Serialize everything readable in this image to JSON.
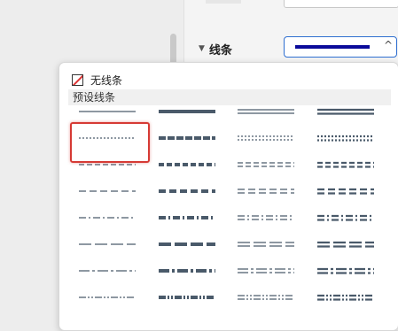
{
  "sidebar": {
    "section_title": "线条"
  },
  "line_select": {
    "preview_color": "#0a0a9a"
  },
  "dropdown": {
    "no_line_label": "无线条",
    "preset_header": "预设线条",
    "line_color": "#4a5a6a",
    "highlight_color": "#d63a34",
    "presets": [
      [
        {
          "name": "thin-solid",
          "style": "solid",
          "weight": "thin"
        },
        {
          "name": "thick-solid",
          "style": "solid",
          "weight": "thick"
        },
        {
          "name": "double-thin",
          "style": "solid",
          "weight": "double"
        },
        {
          "name": "double-thick",
          "style": "solid",
          "weight": "double-thick"
        }
      ],
      [
        {
          "name": "thin-dotted",
          "style": "dotted",
          "weight": "thin",
          "selected": true
        },
        {
          "name": "thick-square-dot",
          "style": "square-dot",
          "weight": "thick"
        },
        {
          "name": "double-dotted",
          "style": "dotted",
          "weight": "double"
        },
        {
          "name": "double-thick-dotted",
          "style": "dotted",
          "weight": "double-thick"
        }
      ],
      [
        {
          "name": "thin-dash",
          "style": "dash",
          "weight": "thin"
        },
        {
          "name": "thick-dash",
          "style": "dash",
          "weight": "thick"
        },
        {
          "name": "double-dash",
          "style": "dash",
          "weight": "double"
        },
        {
          "name": "double-thick-dash",
          "style": "dash",
          "weight": "double-thick"
        }
      ],
      [
        {
          "name": "thin-long-dash",
          "style": "long-dash",
          "weight": "thin"
        },
        {
          "name": "thick-long-dash",
          "style": "long-dash",
          "weight": "thick"
        },
        {
          "name": "double-long-dash",
          "style": "long-dash",
          "weight": "double"
        },
        {
          "name": "double-thick-long-dash",
          "style": "long-dash",
          "weight": "double-thick"
        }
      ],
      [
        {
          "name": "thin-dash-dot",
          "style": "dash-dot",
          "weight": "thin"
        },
        {
          "name": "thick-dash-dot",
          "style": "dash-dot",
          "weight": "thick"
        },
        {
          "name": "double-dash-dot",
          "style": "dash-dot",
          "weight": "double"
        },
        {
          "name": "double-thick-dash-dot",
          "style": "dash-dot",
          "weight": "double-thick"
        }
      ],
      [
        {
          "name": "thin-long-dash-2",
          "style": "long-dash-2",
          "weight": "thin"
        },
        {
          "name": "thick-long-dash-2",
          "style": "long-dash-2",
          "weight": "thick"
        },
        {
          "name": "double-long-dash-2",
          "style": "long-dash-2",
          "weight": "double"
        },
        {
          "name": "double-thick-long-dash-2",
          "style": "long-dash-2",
          "weight": "double-thick"
        }
      ],
      [
        {
          "name": "thin-long-dash-dot",
          "style": "long-dash-dot",
          "weight": "thin"
        },
        {
          "name": "thick-long-dash-dot",
          "style": "long-dash-dot",
          "weight": "thick"
        },
        {
          "name": "double-long-dash-dot",
          "style": "long-dash-dot",
          "weight": "double"
        },
        {
          "name": "double-thick-long-dash-dot",
          "style": "long-dash-dot",
          "weight": "double-thick"
        }
      ],
      [
        {
          "name": "thin-dash-dot-dot",
          "style": "dash-dot-dot",
          "weight": "thin"
        },
        {
          "name": "thick-dash-dot-dot",
          "style": "dash-dot-dot",
          "weight": "thick"
        },
        {
          "name": "double-dash-dot-dot",
          "style": "dash-dot-dot",
          "weight": "double"
        },
        {
          "name": "double-thick-dash-dot-dot",
          "style": "dash-dot-dot",
          "weight": "double-thick"
        }
      ]
    ]
  }
}
